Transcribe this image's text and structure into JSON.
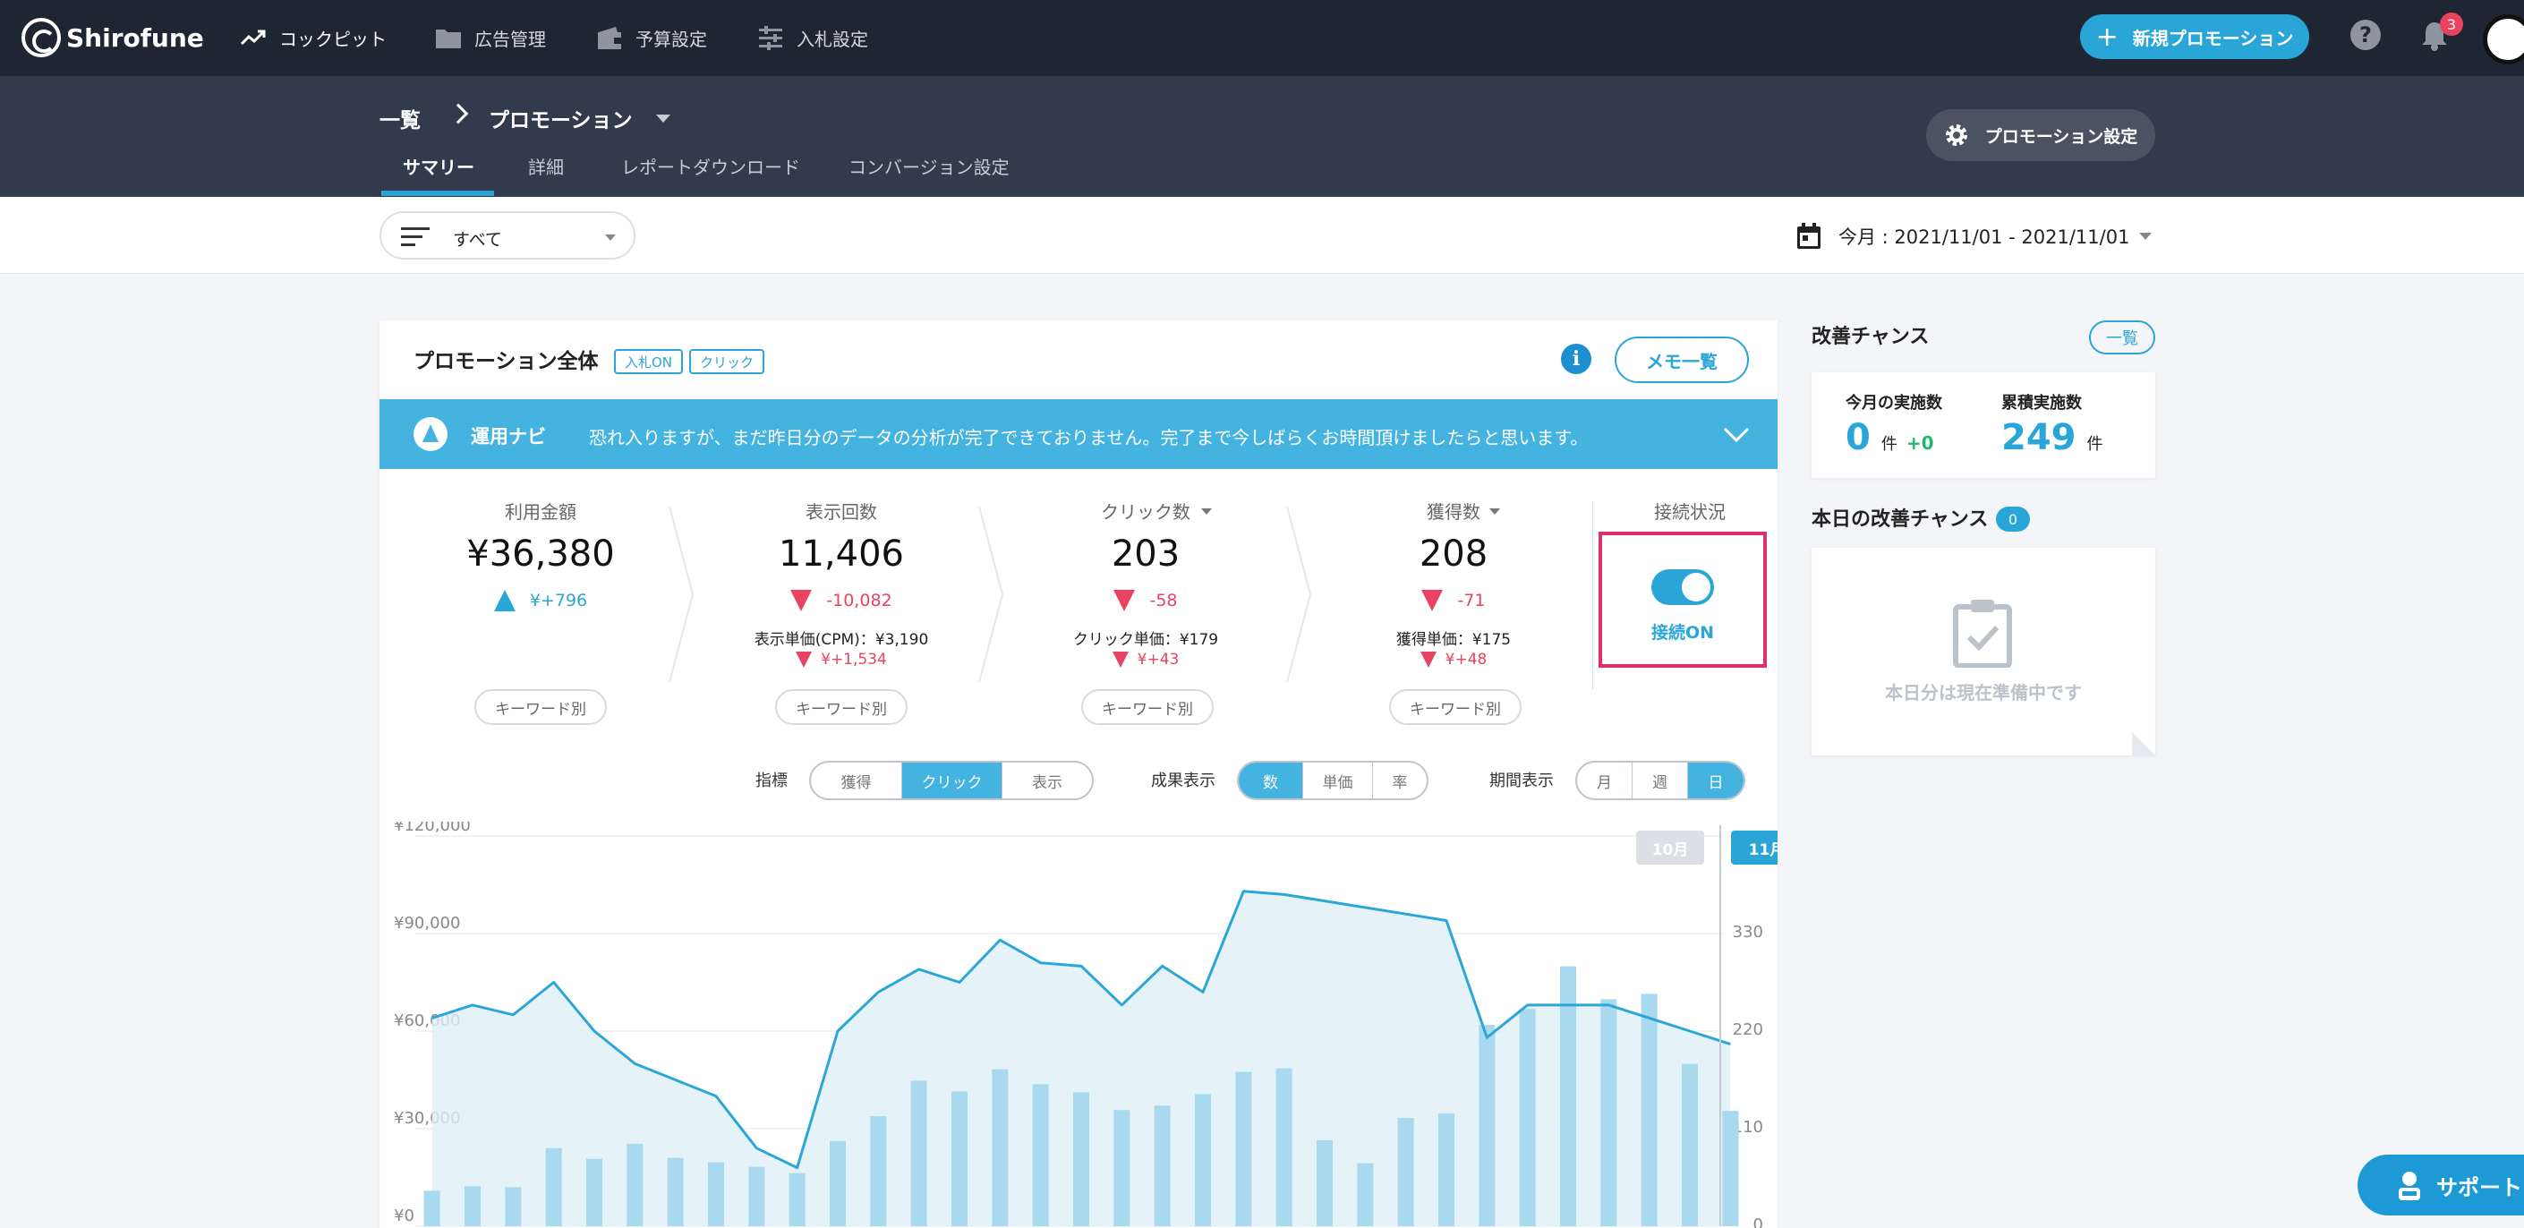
{
  "app": {
    "name": "Shirofune"
  },
  "topnav": {
    "items": [
      {
        "label": "コックピット",
        "icon": "trending-up-icon"
      },
      {
        "label": "広告管理",
        "icon": "folder-icon"
      },
      {
        "label": "予算設定",
        "icon": "wallet-icon"
      },
      {
        "label": "入札設定",
        "icon": "sliders-icon"
      }
    ],
    "new_promotion": "新規プロモーション",
    "notification_count": "3"
  },
  "breadcrumb": {
    "root": "一覧",
    "current": "プロモーション"
  },
  "subtabs": [
    "サマリー",
    "詳細",
    "レポートダウンロード",
    "コンバージョン設定"
  ],
  "promo_settings_label": "プロモーション設定",
  "filter": {
    "value": "すべて"
  },
  "date_range": "今月 : 2021/11/01 - 2021/11/01",
  "card": {
    "title": "プロモーション全体",
    "tags": [
      "入札ON",
      "クリック"
    ],
    "memo_button": "メモ一覧",
    "navi_label": "運用ナビ",
    "navi_message": "恐れ入りますが、まだ昨日分のデータの分析が完了できておりません。完了まで今しばらくお時間頂けましたらと思います。"
  },
  "metrics": [
    {
      "label": "利用金額",
      "value": "¥36,380",
      "delta": "¥+796",
      "direction": "up",
      "keyword_button": "キーワード別"
    },
    {
      "label": "表示回数",
      "value": "11,406",
      "delta": "-10,082",
      "direction": "down",
      "unit_label": "表示単価(CPM)：¥3,190",
      "unit_delta": "¥+1,534",
      "keyword_button": "キーワード別"
    },
    {
      "label": "クリック数",
      "value": "203",
      "delta": "-58",
      "direction": "down",
      "unit_label": "クリック単価：¥179",
      "unit_delta": "¥+43",
      "keyword_button": "キーワード別"
    },
    {
      "label": "獲得数",
      "value": "208",
      "delta": "-71",
      "direction": "down",
      "unit_label": "獲得単価：¥175",
      "unit_delta": "¥+48",
      "keyword_button": "キーワード別"
    }
  ],
  "connection": {
    "label": "接続状況",
    "status": "接続ON",
    "on": true
  },
  "controls": {
    "metric": {
      "label": "指標",
      "options": [
        "獲得",
        "クリック",
        "表示"
      ],
      "selected": 1
    },
    "result": {
      "label": "成果表示",
      "options": [
        "数",
        "単価",
        "率"
      ],
      "selected": 0
    },
    "period": {
      "label": "期間表示",
      "options": [
        "月",
        "週",
        "日"
      ],
      "selected": 2
    }
  },
  "chart_data": {
    "type": "bar",
    "yleft": {
      "ticks": [
        "¥0",
        "¥30,000",
        "¥60,000",
        "¥90,000",
        "¥120,000"
      ],
      "range": [
        0,
        120000
      ]
    },
    "yright": {
      "ticks": [
        "0",
        "110",
        "220",
        "330"
      ],
      "range": [
        0,
        440
      ]
    },
    "months": [
      "10月",
      "11月"
    ],
    "bars": [
      40,
      45,
      44,
      88,
      76,
      93,
      77,
      72,
      67,
      60,
      96,
      124,
      164,
      152,
      177,
      160,
      151,
      131,
      136,
      149,
      174,
      178,
      97,
      71,
      122,
      127,
      227,
      245,
      293,
      256,
      262,
      183,
      130
    ],
    "line": [
      64000,
      68000,
      65000,
      75000,
      60000,
      50000,
      45000,
      40000,
      24000,
      18000,
      60000,
      72000,
      79000,
      75000,
      88000,
      81000,
      80000,
      68000,
      80000,
      72000,
      103000,
      102000,
      100000,
      98000,
      96000,
      94000,
      58000,
      68000,
      68000,
      68000,
      64000,
      60000,
      56000
    ],
    "line_metric": "利用金額",
    "bar_metric": "クリック数",
    "colors": {
      "bar": "#a8d9ee",
      "line": "#2aa6d8",
      "area": "#dff0f8"
    }
  },
  "sidebar": {
    "improve_title": "改善チャンス",
    "list_button": "一覧",
    "monthly": {
      "label": "今月の実施数",
      "value": "0",
      "unit": "件",
      "delta": "+0"
    },
    "total": {
      "label": "累積実施数",
      "value": "249",
      "unit": "件"
    },
    "today_title": "本日の改善チャンス",
    "today_count": "0",
    "empty_text": "本日分は現在準備中です"
  },
  "support_label": "サポート",
  "colors": {
    "nav": "#1f2633",
    "subheader": "#323b4b",
    "accent": "#29a5d8",
    "negative": "#e94361",
    "positive": "#20b86a"
  }
}
